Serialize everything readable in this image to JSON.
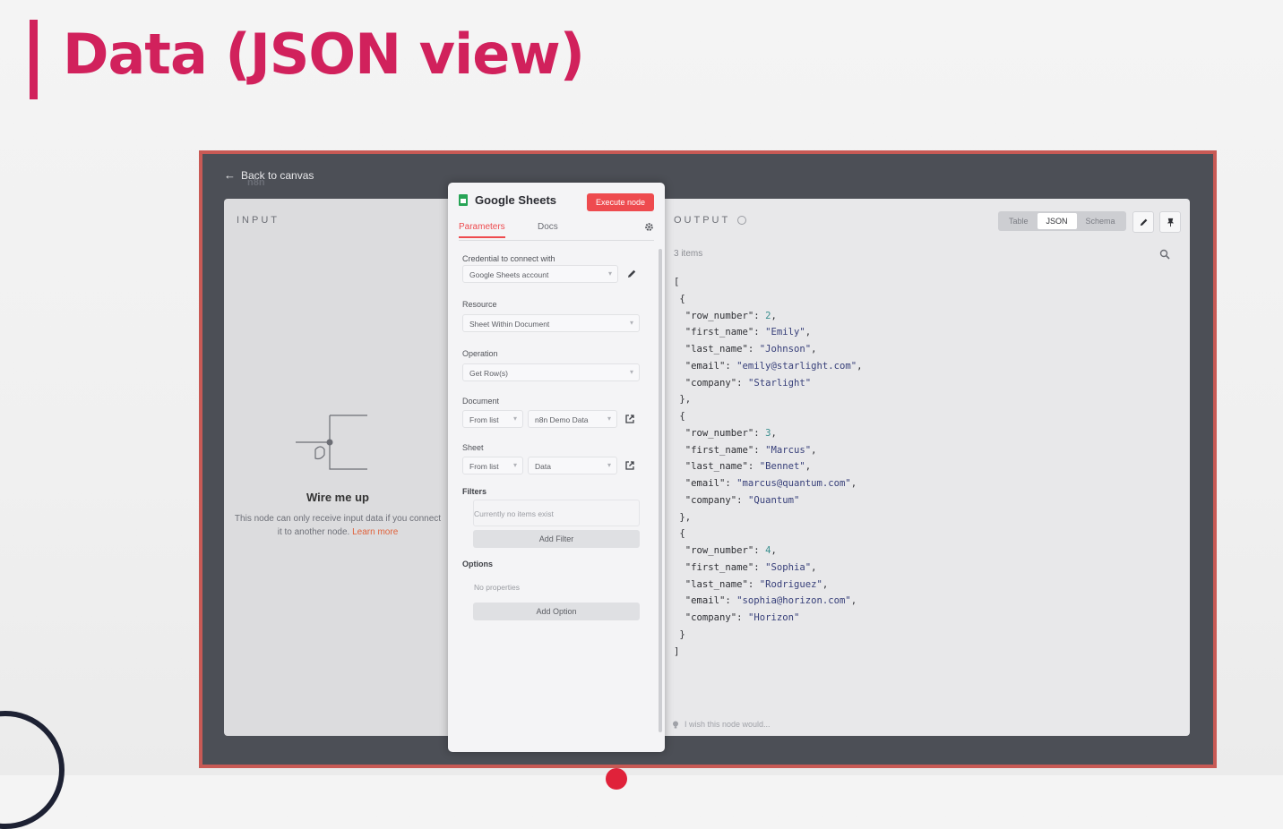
{
  "slide": {
    "title": "Data (JSON view)",
    "accent_color": "#d1215c"
  },
  "app": {
    "back_label": "Back to canvas",
    "logo_text": "n8n"
  },
  "input_panel": {
    "label": "INPUT",
    "wire_title": "Wire me up",
    "wire_text": "This node can only receive input data if you connect it to another node.",
    "learn_more": "Learn more"
  },
  "node": {
    "title": "Google Sheets",
    "execute_label": "Execute node",
    "tabs": [
      "Parameters",
      "Docs"
    ],
    "credential_label": "Credential to connect with",
    "credential_value": "Google Sheets account",
    "resource_label": "Resource",
    "resource_value": "Sheet Within Document",
    "operation_label": "Operation",
    "operation_value": "Get Row(s)",
    "document_label": "Document",
    "document_mode": "From list",
    "document_value": "n8n Demo Data",
    "sheet_label": "Sheet",
    "sheet_mode": "From list",
    "sheet_value": "Data",
    "filters_label": "Filters",
    "filters_empty": "Currently no items exist",
    "add_filter_label": "Add Filter",
    "options_label": "Options",
    "options_empty": "No properties",
    "add_option_label": "Add Option"
  },
  "output_panel": {
    "label": "OUTPUT",
    "view_tabs": [
      "Table",
      "JSON",
      "Schema"
    ],
    "active_view": "JSON",
    "items_count": "3 items",
    "footer_text": "I wish this node would...",
    "items": [
      {
        "row_number": 2,
        "first_name": "Emily",
        "last_name": "Johnson",
        "email": "emily@starlight.com",
        "company": "Starlight"
      },
      {
        "row_number": 3,
        "first_name": "Marcus",
        "last_name": "Bennet",
        "email": "marcus@quantum.com",
        "company": "Quantum"
      },
      {
        "row_number": 4,
        "first_name": "Sophia",
        "last_name": "Rodriguez",
        "email": "sophia@horizon.com",
        "company": "Horizon"
      }
    ]
  },
  "colors": {
    "frame_border": "#c85a55",
    "execute_button": "#ee4b4f",
    "json_number": "#3b8f8f",
    "json_string": "#38407a"
  }
}
